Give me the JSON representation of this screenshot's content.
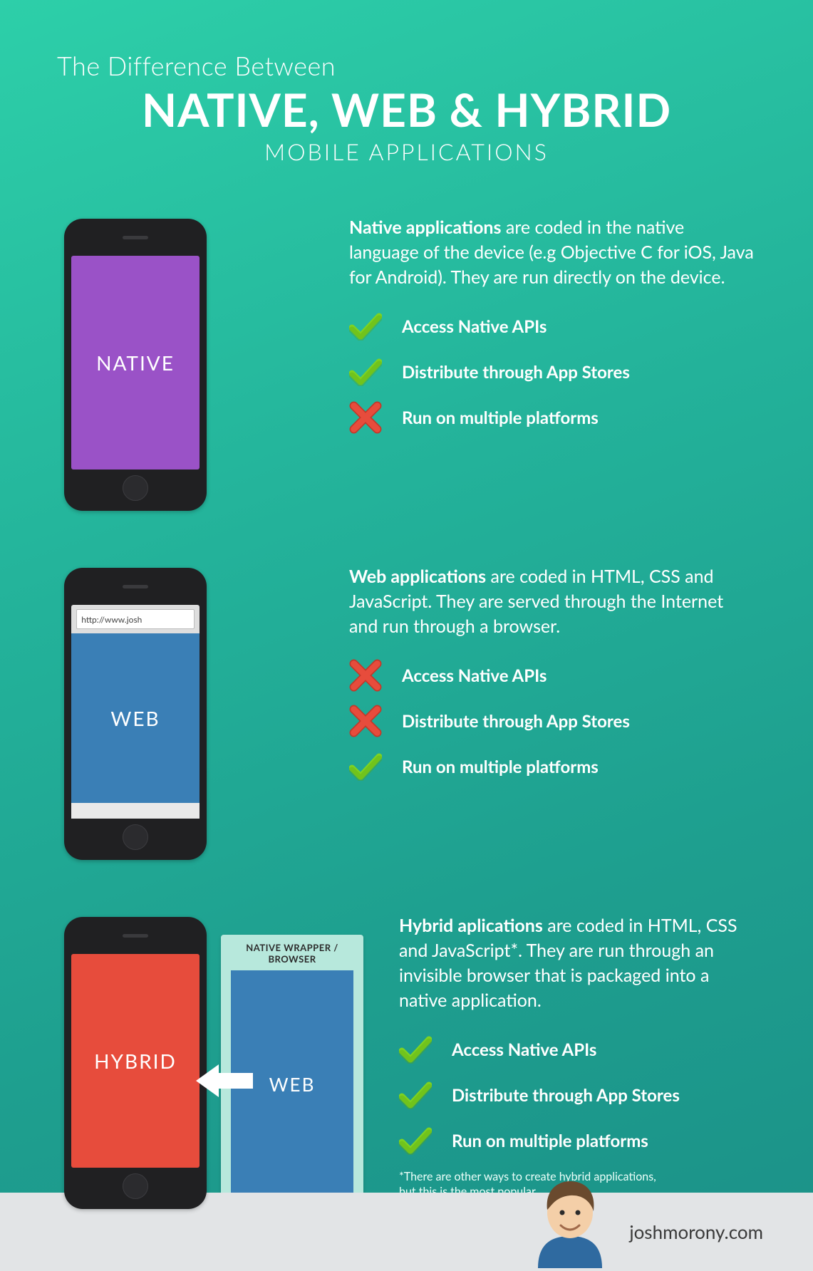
{
  "header": {
    "pre_title": "The Difference Between",
    "main_title": "NATIVE, WEB & HYBRID",
    "sub_title": "MOBILE APPLICATIONS"
  },
  "feature_labels": {
    "api": "Access Native APIs",
    "store": "Distribute through App Stores",
    "multi": "Run on multiple platforms"
  },
  "sections": {
    "native": {
      "phone_label": "NATIVE",
      "screen_color": "#9a52c7",
      "desc_bold": "Native applications",
      "desc_rest": " are coded in the native language of the device (e.g Objective C for iOS, Java for Android). They are run directly on the device.",
      "features": {
        "api": true,
        "store": true,
        "multi": false
      }
    },
    "web": {
      "phone_label": "WEB",
      "url_text": "http://www.josh",
      "screen_color": "#3a7fb6",
      "desc_bold": "Web applications",
      "desc_rest": " are coded in HTML, CSS and JavaScript. They are served through the Internet and run through a browser.",
      "features": {
        "api": false,
        "store": false,
        "multi": true
      }
    },
    "hybrid": {
      "phone_label": "HYBRID",
      "screen_color": "#e74c3c",
      "wrapper_title": "NATIVE WRAPPER / BROWSER",
      "wrapper_inner_label": "WEB",
      "desc_bold": "Hybrid aplications",
      "desc_rest": " are coded in HTML, CSS and JavaScript*.  They are run through an invisible browser that is packaged into a native application.",
      "features": {
        "api": true,
        "store": true,
        "multi": true
      },
      "footnote": "*There are other ways to create hybrid applications,\nbut this is the most popular"
    }
  },
  "footer": {
    "site": "joshmorony.com"
  },
  "icons": {
    "check": "check-icon",
    "cross": "cross-icon"
  }
}
